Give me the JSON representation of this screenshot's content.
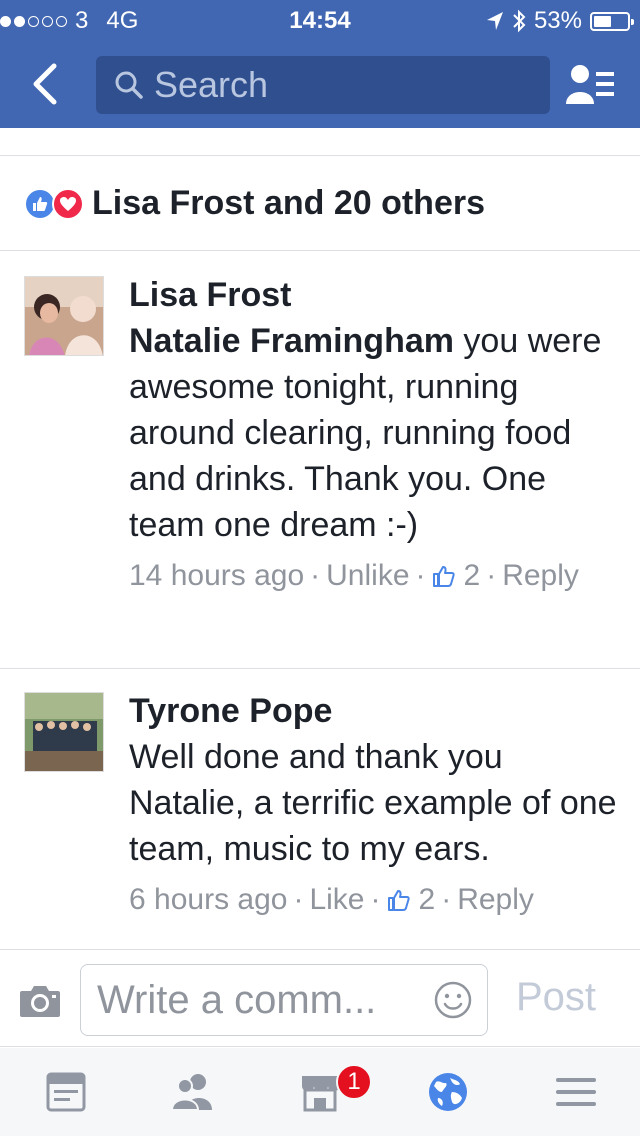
{
  "status_bar": {
    "carrier": "3",
    "network": "4G",
    "time": "14:54",
    "battery": "53%",
    "signal_strength": 2,
    "signal_max": 5,
    "battery_level": 0.53
  },
  "nav": {
    "search_placeholder": "Search",
    "back_icon": "chevron-left-icon",
    "friends_icon": "friends-list-icon"
  },
  "reactions": {
    "summary": "Lisa Frost and 20 others",
    "types": [
      "like-icon",
      "love-icon"
    ]
  },
  "comments": [
    {
      "author": "Lisa Frost",
      "mention": "Natalie Framingham",
      "text": " you were awesome tonight, running around clearing, running food and drinks. Thank you. One team one dream :-)",
      "time": "14 hours ago",
      "action": "Unlike",
      "likes": "2",
      "reply": "Reply"
    },
    {
      "author": "Tyrone Pope",
      "mention": "",
      "text": "Well done and thank you Natalie, a terrific example of one team, music to my ears.",
      "time": "6 hours ago",
      "action": "Like",
      "likes": "2",
      "reply": "Reply"
    }
  ],
  "composer": {
    "placeholder": "Write a comm...",
    "post_label": "Post"
  },
  "tabbar": {
    "items": [
      "news-feed-icon",
      "friends-icon",
      "marketplace-icon",
      "globe-icon",
      "menu-icon"
    ],
    "marketplace_badge": "1"
  },
  "colors": {
    "brand": "#4267b2",
    "like_blue": "#4a86e8",
    "love_red": "#f0284a",
    "badge_red": "#e4101f",
    "meta_gray": "#90949c"
  }
}
